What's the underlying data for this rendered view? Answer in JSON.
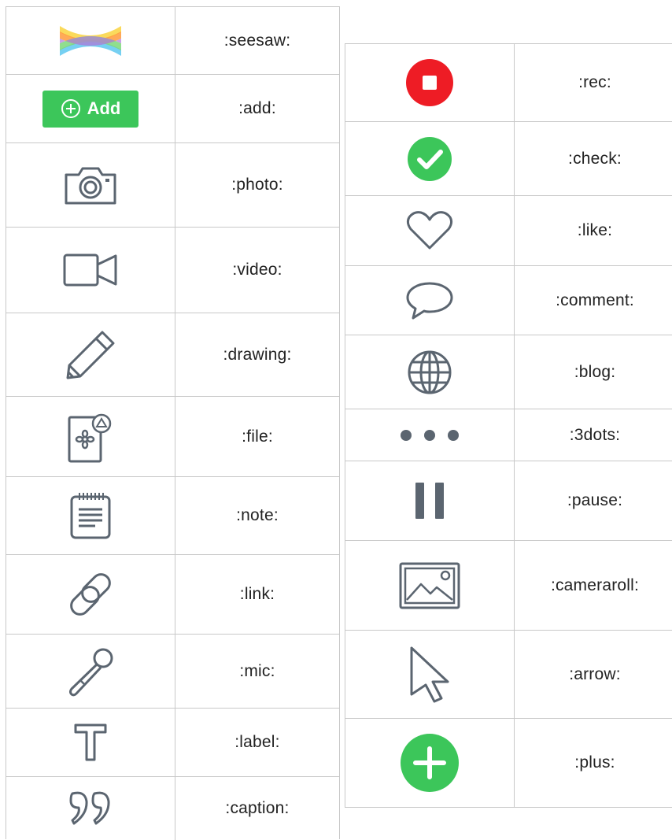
{
  "left_table": {
    "rows": [
      {
        "icon": "seesaw-logo-icon",
        "label": ":seesaw:"
      },
      {
        "icon": "add-button-icon",
        "label": ":add:",
        "button_text": "Add",
        "color": "#3cc65a"
      },
      {
        "icon": "camera-icon",
        "label": ":photo:"
      },
      {
        "icon": "video-camera-icon",
        "label": ":video:"
      },
      {
        "icon": "pencil-icon",
        "label": ":drawing:"
      },
      {
        "icon": "file-icon",
        "label": ":file:"
      },
      {
        "icon": "notepad-icon",
        "label": ":note:"
      },
      {
        "icon": "link-icon",
        "label": ":link:"
      },
      {
        "icon": "microphone-icon",
        "label": ":mic:"
      },
      {
        "icon": "text-t-icon",
        "label": ":label:"
      },
      {
        "icon": "quotation-marks-icon",
        "label": ":caption:"
      }
    ]
  },
  "right_table": {
    "rows": [
      {
        "icon": "record-icon",
        "label": ":rec:",
        "color": "#ee1c25"
      },
      {
        "icon": "check-circle-icon",
        "label": ":check:",
        "color": "#3cc65a"
      },
      {
        "icon": "heart-icon",
        "label": ":like:"
      },
      {
        "icon": "speech-bubble-icon",
        "label": ":comment:"
      },
      {
        "icon": "globe-icon",
        "label": ":blog:"
      },
      {
        "icon": "three-dots-icon",
        "label": ":3dots:"
      },
      {
        "icon": "pause-icon",
        "label": ":pause:"
      },
      {
        "icon": "image-icon",
        "label": ":cameraroll:"
      },
      {
        "icon": "cursor-arrow-icon",
        "label": ":arrow:"
      },
      {
        "icon": "plus-circle-icon",
        "label": ":plus:",
        "color": "#3cc65a"
      }
    ]
  },
  "icon_stroke_color": "#5b6570"
}
